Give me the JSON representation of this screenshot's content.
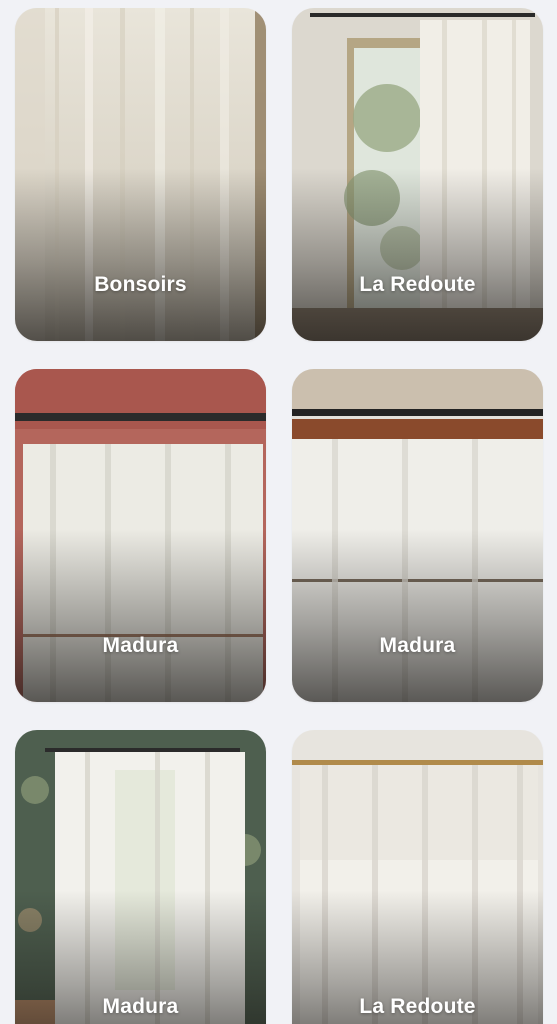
{
  "products": [
    {
      "brand": "Bonsoirs",
      "image_icon": "sheer-linen-curtain-photo"
    },
    {
      "brand": "La Redoute",
      "image_icon": "curtain-by-window-photo"
    },
    {
      "brand": "Madura",
      "image_icon": "curtain-on-black-rod-photo"
    },
    {
      "brand": "Madura",
      "image_icon": "curtain-with-rings-photo"
    },
    {
      "brand": "Madura",
      "image_icon": "bedroom-window-curtain-photo"
    },
    {
      "brand": "La Redoute",
      "image_icon": "tie-top-curtain-photo"
    }
  ]
}
